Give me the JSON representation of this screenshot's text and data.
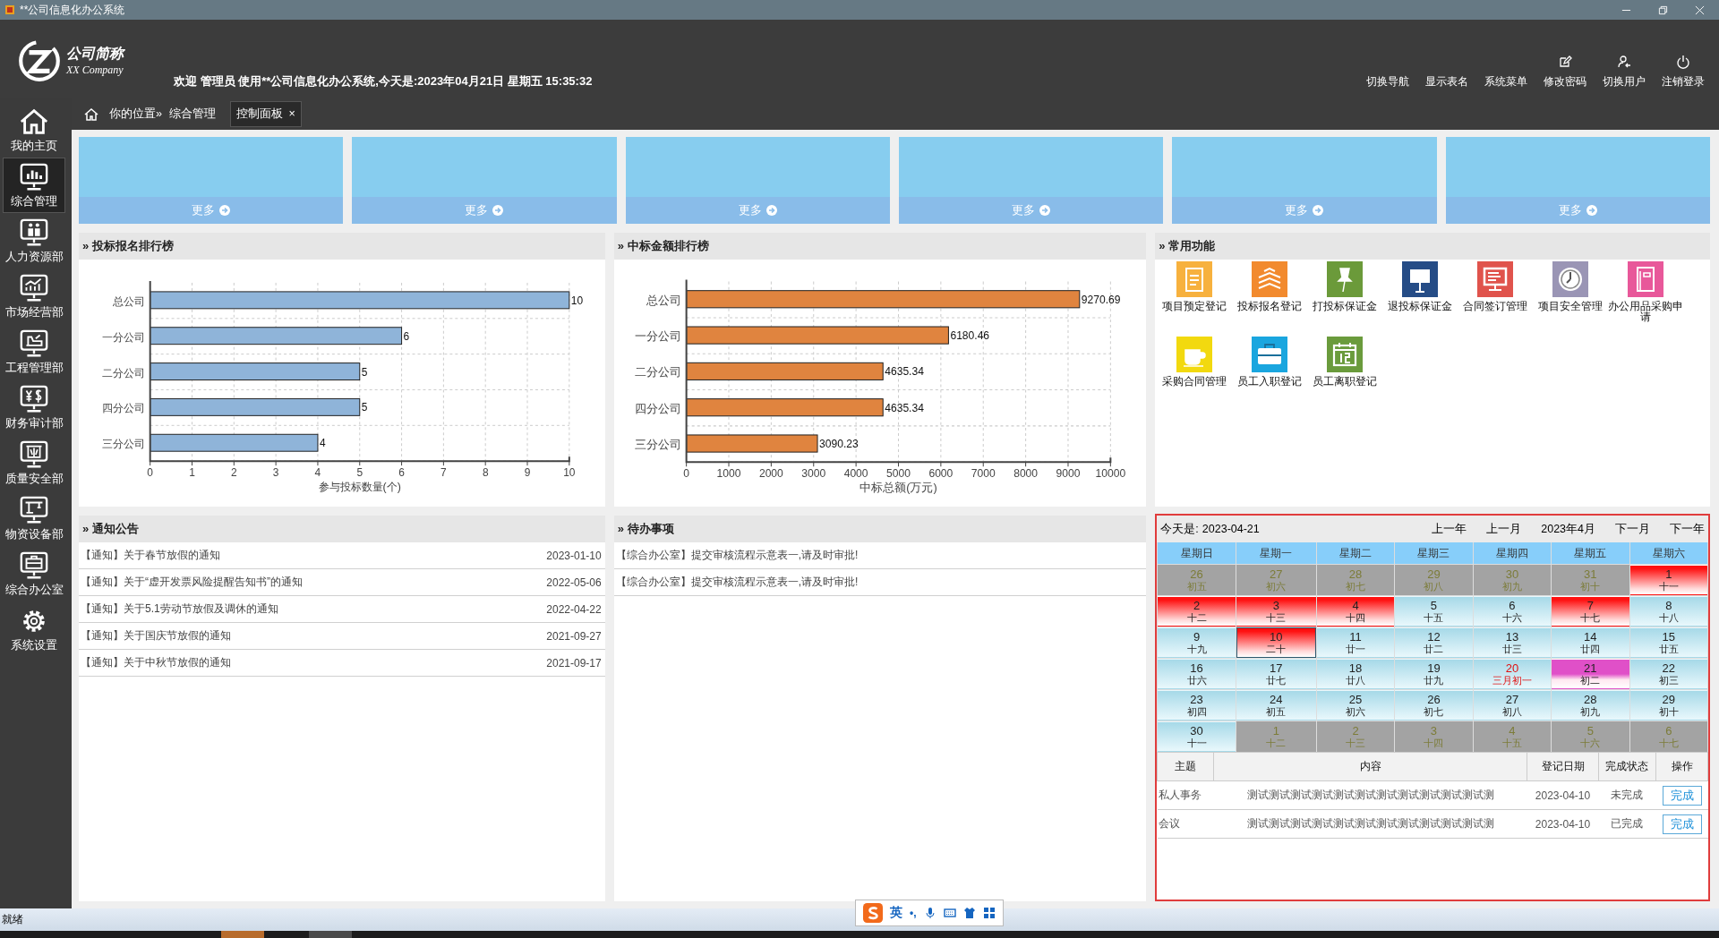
{
  "window": {
    "title": "**公司信息化办公系统"
  },
  "logo": {
    "name": "公司简称",
    "subtitle": "XX Company"
  },
  "welcome": "欢迎 管理员 使用**公司信息化办公系统,今天是:2023年04月21日 星期五 15:35:32",
  "header_menu": [
    {
      "label": "切换导航",
      "kind": "plain"
    },
    {
      "label": "显示表名",
      "kind": "plain"
    },
    {
      "label": "系统菜单",
      "kind": "plain"
    },
    {
      "label": "修改密码",
      "kind": "edit"
    },
    {
      "label": "切换用户",
      "kind": "user"
    },
    {
      "label": "注销登录",
      "kind": "power"
    }
  ],
  "sidebar": {
    "items": [
      {
        "label": "我的主页",
        "selected": false
      },
      {
        "label": "综合管理",
        "selected": true
      },
      {
        "label": "人力资源部",
        "selected": false
      },
      {
        "label": "市场经营部",
        "selected": false
      },
      {
        "label": "工程管理部",
        "selected": false
      },
      {
        "label": "财务审计部",
        "selected": false
      },
      {
        "label": "质量安全部",
        "selected": false
      },
      {
        "label": "物资设备部",
        "selected": false
      },
      {
        "label": "综合办公室",
        "selected": false
      },
      {
        "label": "系统设置",
        "selected": false
      }
    ]
  },
  "breadcrumb": {
    "prefix": "你的位置»",
    "current": "综合管理"
  },
  "tabs": [
    {
      "label": "控制面板",
      "close": "×",
      "selected": true
    }
  ],
  "cards": [
    {
      "more": "更多"
    },
    {
      "more": "更多"
    },
    {
      "more": "更多"
    },
    {
      "more": "更多"
    },
    {
      "more": "更多"
    },
    {
      "more": "更多"
    }
  ],
  "charts": [
    {
      "title": "» 投标报名排行榜",
      "chart_data": {
        "type": "bar",
        "orientation": "horizontal",
        "xlabel": "参与投标数量(个)",
        "categories": [
          "总公司",
          "一分公司",
          "二分公司",
          "四分公司",
          "三分公司"
        ],
        "series": [
          {
            "color": "#8fb4d9",
            "values": [
              10,
              6,
              5,
              5,
              4
            ]
          }
        ],
        "grid": true,
        "xlim": [
          0,
          10
        ],
        "xticks": [
          0,
          1,
          2,
          3,
          4,
          5,
          6,
          7,
          8,
          9,
          10
        ],
        "value_labels": [
          "10",
          "6",
          "5",
          "5",
          "4"
        ]
      }
    },
    {
      "title": "» 中标金额排行榜",
      "chart_data": {
        "type": "bar",
        "orientation": "horizontal",
        "xlabel": "中标总额(万元)",
        "categories": [
          "总公司",
          "一分公司",
          "二分公司",
          "四分公司",
          "三分公司"
        ],
        "series": [
          {
            "color": "#e0843f",
            "values": [
              9270.69,
              6180.46,
              4635.34,
              4635.34,
              3090.23
            ]
          }
        ],
        "grid": true,
        "xlim": [
          0,
          10000
        ],
        "xticks": [
          0,
          1000,
          2000,
          3000,
          4000,
          5000,
          6000,
          7000,
          8000,
          9000,
          10000
        ],
        "value_labels": [
          "9270.69",
          "6180.46",
          "4635.34",
          "4635.34",
          "3090.23"
        ]
      }
    }
  ],
  "quick_functions": {
    "title": "» 常用功能",
    "items": [
      {
        "label": "项目预定登记",
        "color": "#f7b13e"
      },
      {
        "label": "投标报名登记",
        "color": "#f28a2e"
      },
      {
        "label": "打投标保证金",
        "color": "#6b9a3a"
      },
      {
        "label": "退投标保证金",
        "color": "#254c86"
      },
      {
        "label": "合同签订管理",
        "color": "#e0534c"
      },
      {
        "label": "项目安全管理",
        "color": "#9a95b5"
      },
      {
        "label": "办公用品采购申请",
        "color": "#e8589a"
      },
      {
        "label": "采购合同管理",
        "color": "#f2d90f"
      },
      {
        "label": "员工入职登记",
        "color": "#1aa6df"
      },
      {
        "label": "员工离职登记",
        "color": "#6a9b3c"
      }
    ]
  },
  "notices": {
    "title": "» 通知公告",
    "rows": [
      {
        "text": "【通知】关于春节放假的通知",
        "date": "2023-01-10"
      },
      {
        "text": "【通知】关于“虚开发票风险提醒告知书”的通知",
        "date": "2022-05-06"
      },
      {
        "text": "【通知】关于5.1劳动节放假及调休的通知",
        "date": "2022-04-22"
      },
      {
        "text": "【通知】关于国庆节放假的通知",
        "date": "2021-09-27"
      },
      {
        "text": "【通知】关于中秋节放假的通知",
        "date": "2021-09-17"
      }
    ]
  },
  "todos": {
    "title": "» 待办事项",
    "rows": [
      {
        "text": "【综合办公室】提交审核流程示意表一,请及时审批!"
      },
      {
        "text": "【综合办公室】提交审核流程示意表一,请及时审批!"
      }
    ]
  },
  "calendar": {
    "today_label": "今天是:",
    "today": "2023-04-21",
    "nav": [
      "上一年",
      "上一月",
      "2023年4月",
      "下一月",
      "下一年"
    ],
    "weekdays": [
      "星期日",
      "星期一",
      "星期二",
      "星期三",
      "星期四",
      "星期五",
      "星期六"
    ],
    "cells": [
      {
        "day": "26",
        "lunar": "初五",
        "kind": "other",
        "selected": false
      },
      {
        "day": "27",
        "lunar": "初六",
        "kind": "other",
        "selected": false
      },
      {
        "day": "28",
        "lunar": "初七",
        "kind": "other",
        "selected": false
      },
      {
        "day": "29",
        "lunar": "初八",
        "kind": "other",
        "selected": false
      },
      {
        "day": "30",
        "lunar": "初九",
        "kind": "other",
        "selected": false
      },
      {
        "day": "31",
        "lunar": "初十",
        "kind": "other",
        "selected": false
      },
      {
        "day": "1",
        "lunar": "十一",
        "kind": "rest",
        "selected": false
      },
      {
        "day": "2",
        "lunar": "十二",
        "kind": "rest",
        "selected": false
      },
      {
        "day": "3",
        "lunar": "十三",
        "kind": "rest",
        "selected": false
      },
      {
        "day": "4",
        "lunar": "十四",
        "kind": "rest",
        "selected": false
      },
      {
        "day": "5",
        "lunar": "十五",
        "kind": "work",
        "selected": false
      },
      {
        "day": "6",
        "lunar": "十六",
        "kind": "work",
        "selected": false
      },
      {
        "day": "7",
        "lunar": "十七",
        "kind": "rest",
        "selected": false
      },
      {
        "day": "8",
        "lunar": "十八",
        "kind": "work",
        "selected": false
      },
      {
        "day": "9",
        "lunar": "十九",
        "kind": "work",
        "selected": false
      },
      {
        "day": "10",
        "lunar": "二十",
        "kind": "rest",
        "selected": true
      },
      {
        "day": "11",
        "lunar": "廿一",
        "kind": "work",
        "selected": false
      },
      {
        "day": "12",
        "lunar": "廿二",
        "kind": "work",
        "selected": false
      },
      {
        "day": "13",
        "lunar": "廿三",
        "kind": "work",
        "selected": false
      },
      {
        "day": "14",
        "lunar": "廿四",
        "kind": "work",
        "selected": false
      },
      {
        "day": "15",
        "lunar": "廿五",
        "kind": "work",
        "selected": false
      },
      {
        "day": "16",
        "lunar": "廿六",
        "kind": "work",
        "selected": false
      },
      {
        "day": "17",
        "lunar": "廿七",
        "kind": "work",
        "selected": false
      },
      {
        "day": "18",
        "lunar": "廿八",
        "kind": "work",
        "selected": false
      },
      {
        "day": "19",
        "lunar": "廿九",
        "kind": "work",
        "selected": false
      },
      {
        "day": "20",
        "lunar": "三月初一",
        "kind": "festival",
        "selected": false
      },
      {
        "day": "21",
        "lunar": "初二",
        "kind": "today",
        "selected": false
      },
      {
        "day": "22",
        "lunar": "初三",
        "kind": "work",
        "selected": false
      },
      {
        "day": "23",
        "lunar": "初四",
        "kind": "work",
        "selected": false
      },
      {
        "day": "24",
        "lunar": "初五",
        "kind": "work",
        "selected": false
      },
      {
        "day": "25",
        "lunar": "初六",
        "kind": "work",
        "selected": false
      },
      {
        "day": "26",
        "lunar": "初七",
        "kind": "work",
        "selected": false
      },
      {
        "day": "27",
        "lunar": "初八",
        "kind": "work",
        "selected": false
      },
      {
        "day": "28",
        "lunar": "初九",
        "kind": "work",
        "selected": false
      },
      {
        "day": "29",
        "lunar": "初十",
        "kind": "work",
        "selected": false
      },
      {
        "day": "30",
        "lunar": "十一",
        "kind": "work",
        "selected": false
      },
      {
        "day": "1",
        "lunar": "十二",
        "kind": "other",
        "selected": false
      },
      {
        "day": "2",
        "lunar": "十三",
        "kind": "other",
        "selected": false
      },
      {
        "day": "3",
        "lunar": "十四",
        "kind": "other",
        "selected": false
      },
      {
        "day": "4",
        "lunar": "十五",
        "kind": "other",
        "selected": false
      },
      {
        "day": "5",
        "lunar": "十六",
        "kind": "other",
        "selected": false
      },
      {
        "day": "6",
        "lunar": "十七",
        "kind": "other",
        "selected": false
      }
    ],
    "table": {
      "columns": [
        "主题",
        "内容",
        "登记日期",
        "完成状态",
        "操作"
      ],
      "rows": [
        {
          "subject": "私人事务",
          "content": "测试测试测试测试测试测试测试测试测试测试测试测",
          "date": "2023-04-10",
          "status": "未完成",
          "action": "完成"
        },
        {
          "subject": "会议",
          "content": "测试测试测试测试测试测试测试测试测试测试测试测",
          "date": "2023-04-10",
          "status": "已完成",
          "action": "完成"
        }
      ]
    }
  },
  "status_bar": {
    "text": "就绪"
  },
  "ime": {
    "mode": "英",
    "punct": "•,"
  }
}
